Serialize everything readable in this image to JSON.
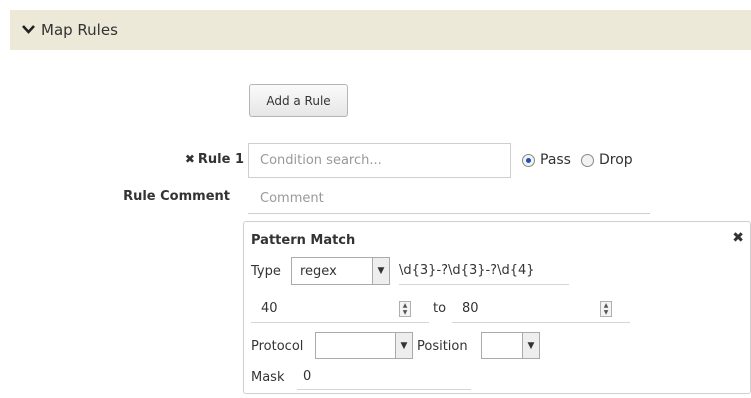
{
  "section": {
    "title": "Map Rules",
    "expand_icon": "chevron-down-icon"
  },
  "add_rule": {
    "label": "Add a Rule"
  },
  "rule": {
    "label": "Rule 1",
    "remove_icon": "close-icon",
    "condition_placeholder": "Condition search...",
    "action_options": [
      "Pass",
      "Drop"
    ],
    "selected_action": "Pass",
    "comment_label": "Rule Comment",
    "comment_placeholder": "Comment"
  },
  "pattern": {
    "title": "Pattern Match",
    "type_label": "Type",
    "type_value": "regex",
    "regex_value": "\\d{3}-?\\d{3}-?\\d{4}",
    "range_from": "40",
    "range_to_label": "to",
    "range_to": "80",
    "protocol_label": "Protocol",
    "protocol_value": "",
    "position_label": "Position",
    "position_value": "",
    "mask_label": "Mask",
    "mask_value": "0"
  }
}
